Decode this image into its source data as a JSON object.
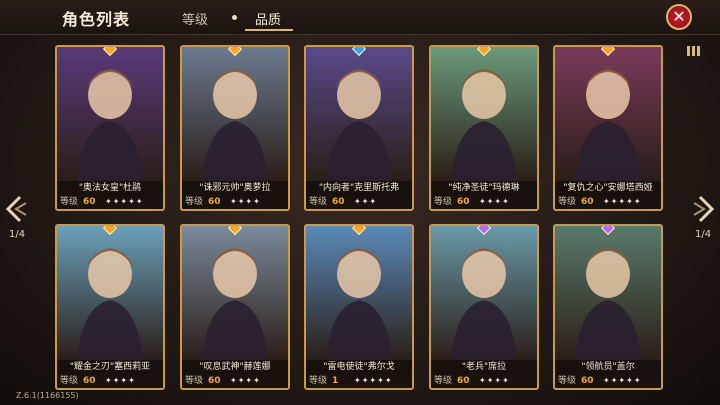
{
  "header": {
    "title": "角色列表",
    "tab_level": "等级",
    "tab_quality": "品质",
    "close_glyph": "✕"
  },
  "nav": {
    "page_left": "1/4",
    "page_right": "1/4"
  },
  "version": "Z.6.1(1166155)",
  "colors": {
    "accent_gold": "#d9b774",
    "level_orange": "#f0a83a",
    "gem_orange": "#f5a52a",
    "gem_blue": "#3aa2f5",
    "gem_purple": "#b46bf0"
  },
  "cards": [
    {
      "name": "\"奥法女皇\"杜鹃",
      "level_label": "等级",
      "level": "60",
      "stars": "✦✦✦✦✦",
      "gem": "orange",
      "bg": "#5a3a7a"
    },
    {
      "name": "\"诛邪元帅\"奥萝拉",
      "level_label": "等级",
      "level": "60",
      "stars": "✦✦✦✦",
      "gem": "orange",
      "bg": "#6b7a8f"
    },
    {
      "name": "\"内向者\"克里斯托弗",
      "level_label": "等级",
      "level": "60",
      "stars": "✦✦✦",
      "gem": "blue",
      "bg": "#5a4a8a"
    },
    {
      "name": "\"纯净圣徒\"玛德琳",
      "level_label": "等级",
      "level": "60",
      "stars": "✦✦✦✦",
      "gem": "orange",
      "bg": "#6a9a7a"
    },
    {
      "name": "\"复仇之心\"安娜塔西娅",
      "level_label": "等级",
      "level": "60",
      "stars": "✦✦✦✦✦",
      "gem": "orange",
      "bg": "#7a3a5a"
    },
    {
      "name": "\"耀金之刃\"塞西莉亚",
      "level_label": "等级",
      "level": "60",
      "stars": "✦✦✦✦",
      "gem": "orange",
      "bg": "#6aa0b8"
    },
    {
      "name": "\"叹息武神\"赫莲娜",
      "level_label": "等级",
      "level": "60",
      "stars": "✦✦✦✦",
      "gem": "orange",
      "bg": "#7a8a9a"
    },
    {
      "name": "\"雷电使徒\"弗尔戈",
      "level_label": "等级",
      "level": "1",
      "stars": "✦✦✦✦✦",
      "gem": "orange",
      "bg": "#5a8ab8"
    },
    {
      "name": "\"老兵\"席拉",
      "level_label": "等级",
      "level": "60",
      "stars": "✦✦✦✦",
      "gem": "purple",
      "bg": "#6a9aa8"
    },
    {
      "name": "\"领航员\"盖尔",
      "level_label": "等级",
      "level": "60",
      "stars": "✦✦✦✦✦",
      "gem": "purple",
      "bg": "#5a7a6a"
    }
  ]
}
